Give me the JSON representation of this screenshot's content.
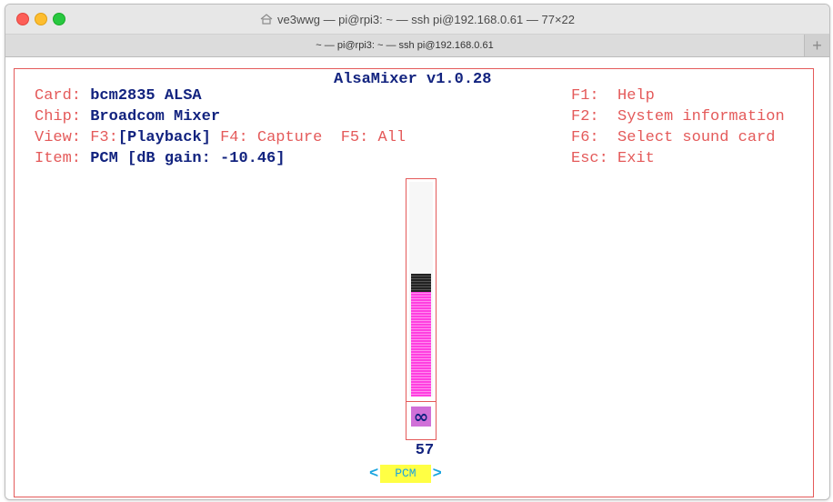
{
  "window": {
    "title": "ve3wwg — pi@rpi3: ~ — ssh pi@192.168.0.61 — 77×22",
    "tab_label": "~ — pi@rpi3: ~ — ssh pi@192.168.0.61",
    "new_tab": "+"
  },
  "mixer": {
    "title": "AlsaMixer v1.0.28",
    "card_label": "Card:",
    "card_value": "bcm2835 ALSA",
    "chip_label": "Chip:",
    "chip_value": "Broadcom Mixer",
    "view_label": "View:",
    "view_f3": "F3:",
    "view_playback": "[Playback]",
    "view_f4": "F4: Capture",
    "view_f5": "F5: All",
    "item_label": "Item:",
    "item_value": "PCM [dB gain: -10.46]",
    "help": [
      {
        "key": "F1:",
        "text": "Help"
      },
      {
        "key": "F2:",
        "text": "System information"
      },
      {
        "key": "F6:",
        "text": "Select sound card"
      },
      {
        "key": "Esc:",
        "text": "Exit"
      }
    ],
    "control": {
      "level_percent": 57,
      "value_text": "57",
      "mute_symbol": "∞",
      "name": "PCM",
      "left_arrow": "<",
      "right_arrow": ">"
    }
  },
  "colors": {
    "label": "#e45a5a",
    "value": "#12237f",
    "level": "#ff3fe0",
    "channel_bg": "#ffff44",
    "channel_text": "#1aa5e0"
  },
  "icons": [
    "close-icon",
    "minimize-icon",
    "maximize-icon",
    "home-icon"
  ]
}
